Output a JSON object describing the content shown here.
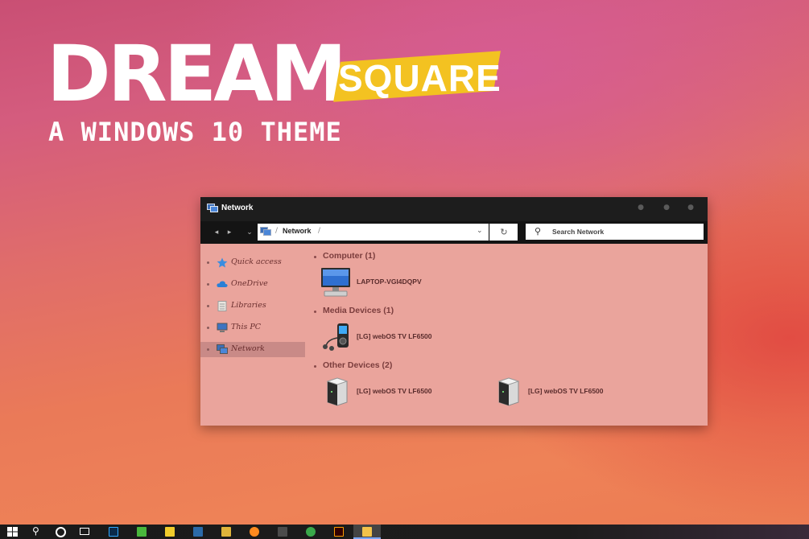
{
  "banner": {
    "title": "DREAM",
    "title_accent": "SQUARE",
    "subtitle": "A WINDOWS 10 THEME",
    "accent_color": "#f3c221"
  },
  "window": {
    "title": "Network",
    "controls": [
      "minimize-icon",
      "maximize-icon",
      "close-icon"
    ],
    "address": {
      "path": "Network",
      "separator": "/"
    },
    "search": {
      "placeholder": "Search Network"
    },
    "sidebar": [
      {
        "label": "Quick access",
        "icon": "star-icon",
        "selected": false
      },
      {
        "label": "OneDrive",
        "icon": "cloud-icon",
        "selected": false
      },
      {
        "label": "Libraries",
        "icon": "library-icon",
        "selected": false
      },
      {
        "label": "This PC",
        "icon": "computer-icon",
        "selected": false
      },
      {
        "label": "Network",
        "icon": "network-icon",
        "selected": true
      }
    ],
    "groups": [
      {
        "label": "Computer (1)",
        "items": [
          {
            "label": "LAPTOP-VGI4DQPV",
            "icon": "monitor-icon"
          }
        ]
      },
      {
        "label": "Media Devices (1)",
        "items": [
          {
            "label": "[LG] webOS TV LF6500",
            "icon": "media-player-icon"
          }
        ]
      },
      {
        "label": "Other Devices (2)",
        "items": [
          {
            "label": "[LG] webOS TV LF6500",
            "icon": "device-tower-icon"
          },
          {
            "label": "[LG] webOS TV LF6500",
            "icon": "device-tower-icon"
          }
        ]
      }
    ]
  },
  "taskbar": {
    "icons": [
      "windows-start-icon",
      "search-icon",
      "cortana-icon",
      "task-view-icon",
      "photoshop-icon",
      "evernote-icon",
      "sticky-notes-icon",
      "tools-icon",
      "gallery-icon",
      "firefox-icon",
      "media-icon",
      "chrome-icon",
      "illustrator-icon",
      "file-explorer-icon"
    ]
  }
}
